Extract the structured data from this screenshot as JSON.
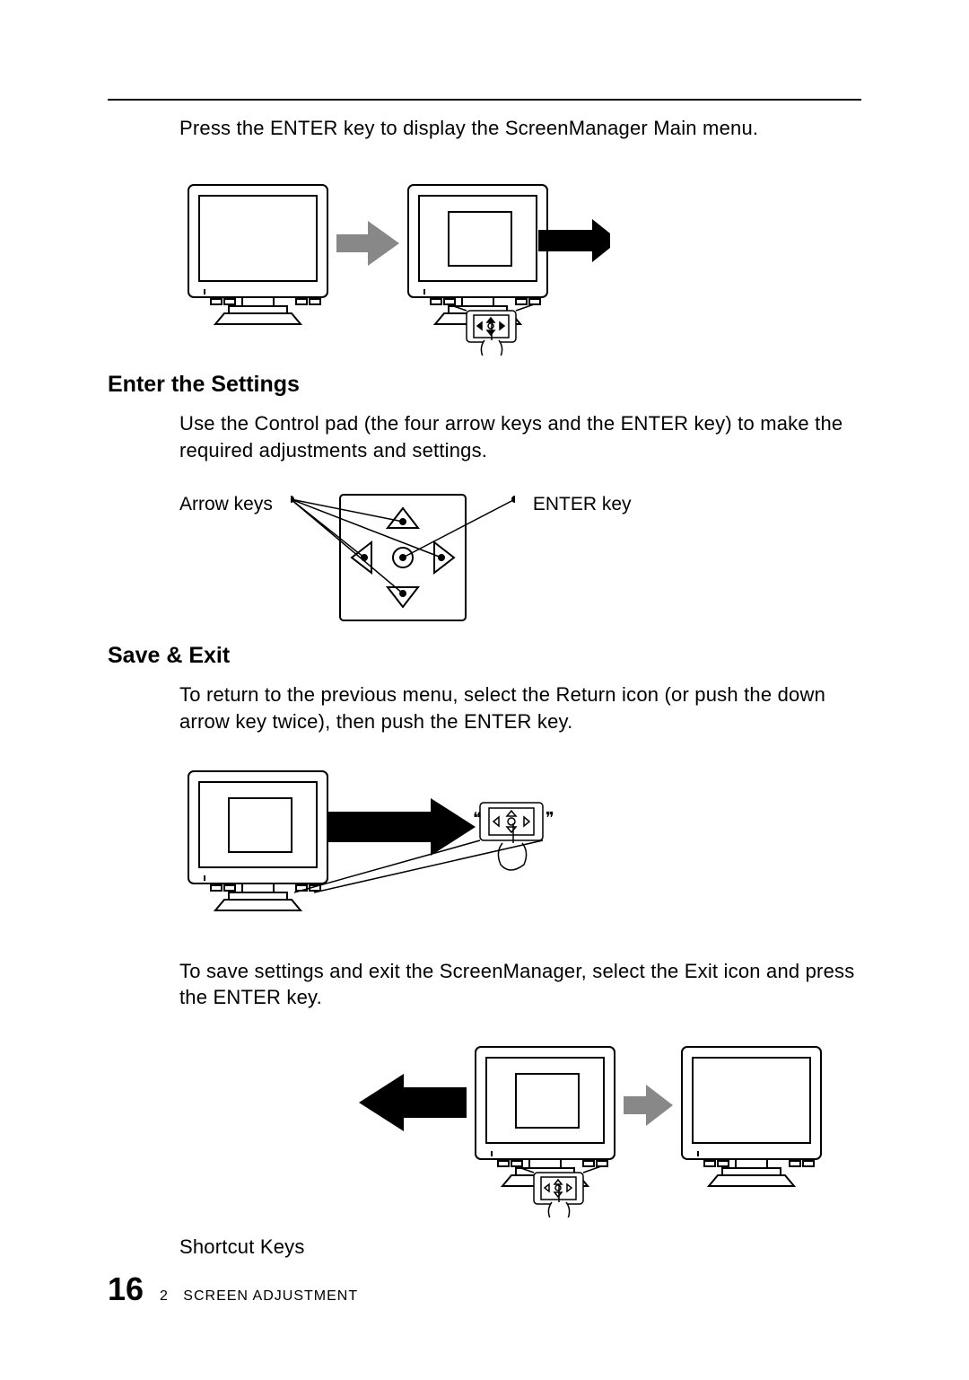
{
  "intro": "Press the ENTER key to display the ScreenManager Main menu.",
  "heading_enter": "Enter the Settings",
  "para_enter": "Use the Control pad (the four arrow keys and the ENTER key) to make the required adjustments and settings.",
  "label_arrow": "Arrow keys",
  "label_enter": "ENTER key",
  "heading_save": "Save & Exit",
  "para_return": "To return to the previous menu, select the Return icon (or push the   down arrow key twice), then push the ENTER key.",
  "para_save": "To save settings and exit the ScreenManager, select the Exit icon and press the ENTER key.",
  "shortcut_label": "Shortcut Keys",
  "footer": {
    "page": "16",
    "chapter_num": "2",
    "chapter_title": "SCREEN ADJUSTMENT"
  }
}
